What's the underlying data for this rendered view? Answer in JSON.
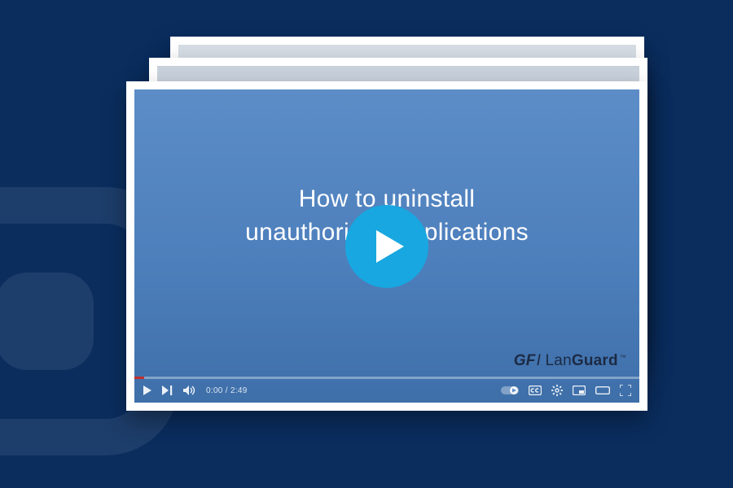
{
  "video": {
    "title_line1": "How to uninstall",
    "title_line2": "unauthorized applications",
    "brand_prefix": "GF",
    "brand_i": "I",
    "brand_name_light": "Lan",
    "brand_name_bold": "Guard",
    "brand_tm": "™"
  },
  "player": {
    "current_time": "0:00",
    "duration": "2:49"
  }
}
